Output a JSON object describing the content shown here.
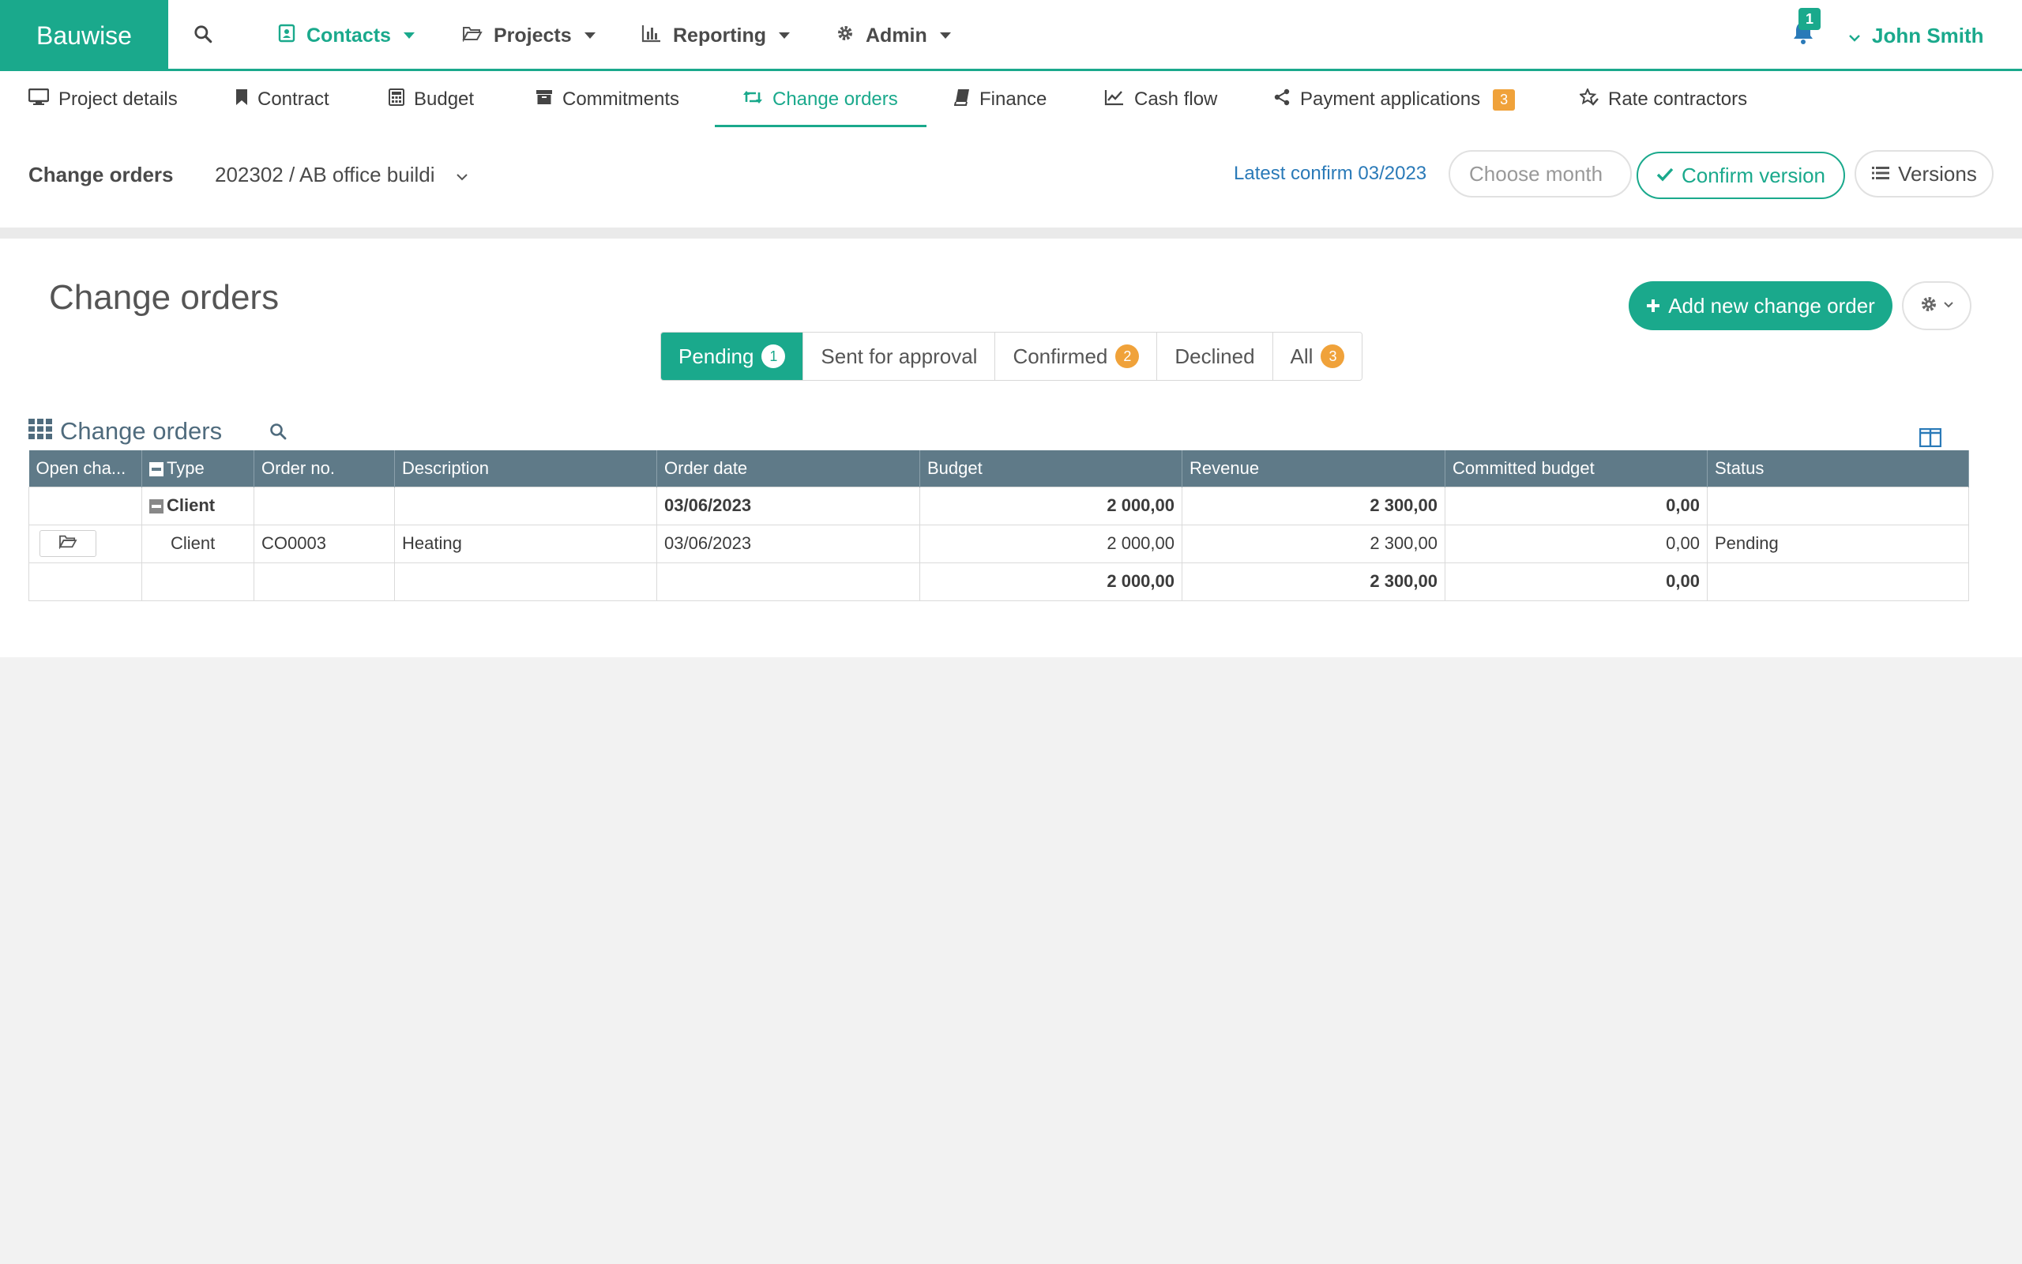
{
  "app": {
    "brand": "Bauwise",
    "accent": "#1aa98c"
  },
  "topnav": {
    "items": [
      {
        "label": "Contacts",
        "icon": "contacts-icon",
        "active": true
      },
      {
        "label": "Projects",
        "icon": "folder-open-icon"
      },
      {
        "label": "Reporting",
        "icon": "bar-chart-icon"
      },
      {
        "label": "Admin",
        "icon": "gear-icon"
      }
    ],
    "notifications": "1",
    "user": "John Smith"
  },
  "project_tabs": [
    {
      "label": "Project details",
      "icon": "monitor-icon"
    },
    {
      "label": "Contract",
      "icon": "bookmark-icon"
    },
    {
      "label": "Budget",
      "icon": "calculator-icon"
    },
    {
      "label": "Commitments",
      "icon": "archive-icon"
    },
    {
      "label": "Change orders",
      "icon": "retweet-icon",
      "active": true
    },
    {
      "label": "Finance",
      "icon": "book-icon"
    },
    {
      "label": "Cash flow",
      "icon": "line-chart-icon"
    },
    {
      "label": "Payment applications",
      "icon": "share-icon",
      "badge": "3"
    },
    {
      "label": "Rate contractors",
      "icon": "star-check-icon"
    }
  ],
  "header": {
    "label": "Change orders",
    "project": "202302 / AB office buildi",
    "latest_confirm": "Latest confirm 03/2023",
    "month_placeholder": "Choose month",
    "confirm_label": "Confirm version",
    "versions_label": "Versions"
  },
  "panel": {
    "title": "Change orders",
    "add_label": "Add new change order",
    "filters": [
      {
        "label": "Pending",
        "count": "1",
        "active": true
      },
      {
        "label": "Sent for approval"
      },
      {
        "label": "Confirmed",
        "count": "2"
      },
      {
        "label": "Declined"
      },
      {
        "label": "All",
        "count": "3"
      }
    ]
  },
  "grid": {
    "title": "Change orders",
    "columns": [
      "Open cha...",
      "Type",
      "Order no.",
      "Description",
      "Order date",
      "Budget",
      "Revenue",
      "Committed budget",
      "Status"
    ],
    "group": {
      "type": "Client",
      "order_date": "03/06/2023",
      "budget": "2 000,00",
      "revenue": "2 300,00",
      "committed": "0,00"
    },
    "rows": [
      {
        "type": "Client",
        "order_no": "CO0003",
        "description": "Heating",
        "order_date": "03/06/2023",
        "budget": "2 000,00",
        "revenue": "2 300,00",
        "committed": "0,00",
        "status": "Pending"
      }
    ],
    "totals": {
      "budget": "2 000,00",
      "revenue": "2 300,00",
      "committed": "0,00"
    }
  }
}
